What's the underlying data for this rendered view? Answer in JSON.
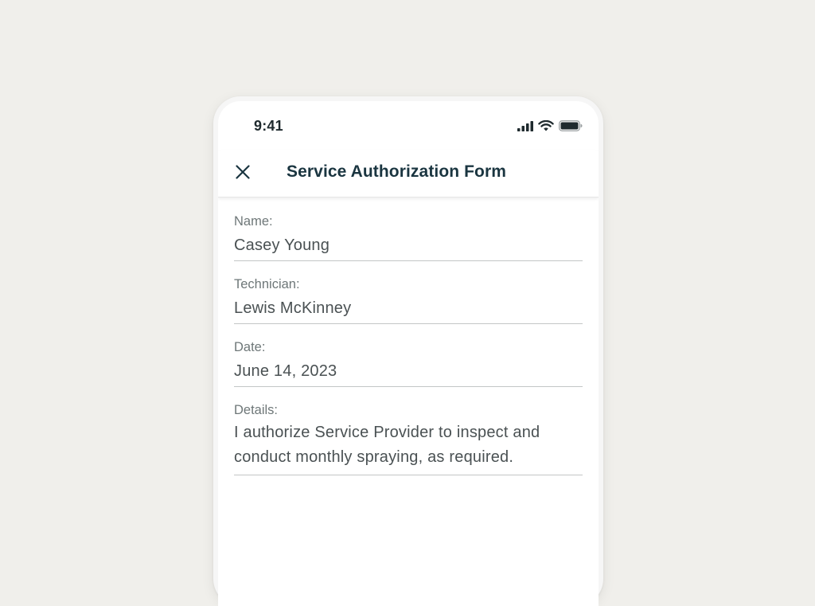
{
  "status_bar": {
    "time": "9:41",
    "icons": [
      "cellular-signal-icon",
      "wifi-icon",
      "battery-icon"
    ]
  },
  "nav": {
    "close_icon": "close-icon",
    "title": "Service Authorization Form"
  },
  "form": {
    "name": {
      "label": "Name:",
      "value": "Casey Young"
    },
    "technician": {
      "label": "Technician:",
      "value": "Lewis McKinney"
    },
    "date": {
      "label": "Date:",
      "value": "June 14, 2023"
    },
    "details": {
      "label": "Details:",
      "value": "I authorize Service Provider to inspect and conduct monthly spraying, as required."
    }
  },
  "colors": {
    "background": "#f0efeb",
    "title": "#1a3540",
    "label": "#6e7778",
    "value": "#4a5153",
    "divider": "#c3c6c6"
  }
}
